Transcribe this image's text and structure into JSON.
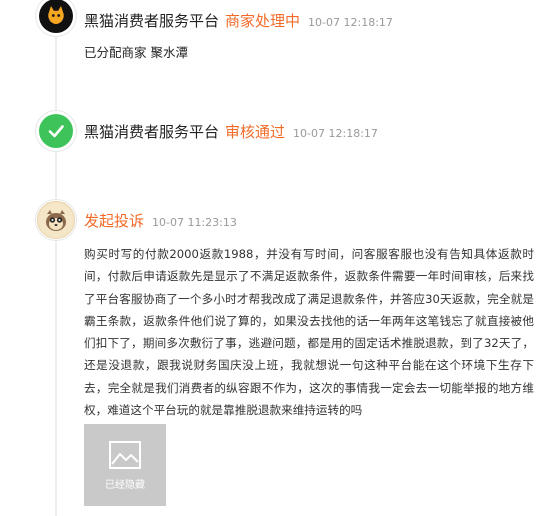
{
  "timeline": [
    {
      "source": "黑猫消费者服务平台",
      "status": "商家处理中",
      "time": "10-07 12:18:17",
      "detail": "已分配商家 聚水潭",
      "icon": "black-cat-icon"
    },
    {
      "source": "黑猫消费者服务平台",
      "status": "审核通过",
      "time": "10-07 12:18:17",
      "icon": "check-icon"
    },
    {
      "status": "发起投诉",
      "time": "10-07 11:23:13",
      "icon": "user-avatar-icon",
      "body": "购买时写的付款2000返款1988，并没有写时间，问客服客服也没有告知具体返款时间，付款后申请返款先是显示了不满足返款条件，返款条件需要一年时间审核，后来找了平台客服协商了一个多小时才帮我改成了满足退款条件，并答应30天返款，完全就是霸王条款，返款条件他们说了算的，如果没去找他的话一年两年这笔钱忘了就直接被他们扣下了，期间多次敷衍了事，逃避问题，都是用的固定话术推脱退款，到了32天了，还是没退款，跟我说财务国庆没上班，我就想说一句这种平台能在这个环境下生存下去，完全就是我们消费者的纵容跟不作为，这次的事情我一定会去一切能举报的地方维权，难道这个平台玩的就是靠推脱退款来维持运转的吗",
      "attachment_label": "已经隐藏"
    }
  ],
  "colors": {
    "accent": "#f26b29",
    "success": "#3ec35b",
    "muted": "#999999"
  }
}
